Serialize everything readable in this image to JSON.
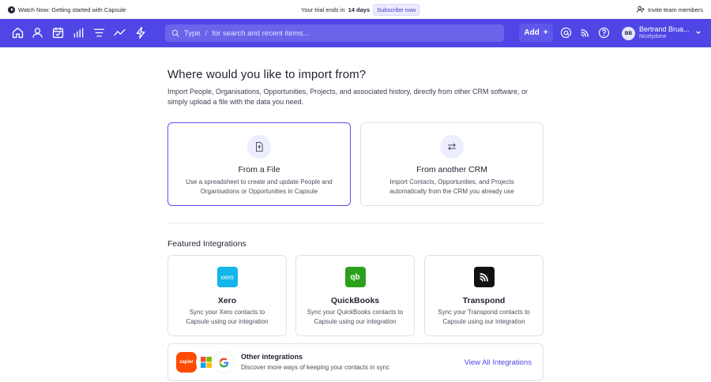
{
  "topbar": {
    "watch_label": "Watch Now: Getting started with Capsule",
    "trial_prefix": "Your trial ends in",
    "trial_days": "14 days",
    "subscribe_label": "Subscribe now",
    "invite_label": "Invite team members"
  },
  "navbar": {
    "icons": [
      "home-icon",
      "person-icon",
      "calendar-icon",
      "reports-icon",
      "filters-icon",
      "activity-icon",
      "workflow-icon"
    ],
    "search_type_label": "Type",
    "search_slash": "/",
    "search_placeholder": "for search and recent items...",
    "add_label": "Add",
    "add_symbol": "+",
    "user_initials": "BB",
    "user_name": "Bertrand Brua...",
    "user_org": "Nicelydone"
  },
  "main": {
    "title": "Where would you like to import from?",
    "intro": "Import People, Organisations, Opportunities, Projects, and associated history, directly from other CRM software, or simply upload a file with the data you need.",
    "options": [
      {
        "title": "From a File",
        "desc": "Use a spreadsheet to create and update People and Organisations or Opportunities in Capsule",
        "icon": "file-upload-icon"
      },
      {
        "title": "From another CRM",
        "desc": "Import Contacts, Opportunities, and Projects automatically from the CRM you already use",
        "icon": "transfer-arrows-icon"
      }
    ],
    "featured_title": "Featured Integrations",
    "integrations": [
      {
        "title": "Xero",
        "desc": "Sync your Xero contacts to Capsule using our integration",
        "logo_text": "xero",
        "color": "#13b5ea"
      },
      {
        "title": "QuickBooks",
        "desc": "Sync your QuickBooks contacts to Capsule using our integration",
        "logo_text": "qb",
        "color": "#2ca01c"
      },
      {
        "title": "Transpond",
        "desc": "Sync your Transpond contacts to Capsule using our integration",
        "logo_text": "",
        "color": "#111111"
      }
    ],
    "other": {
      "title": "Other integrations",
      "desc": "Discover more ways of keeping your contacts in sync",
      "link": "View All Integrations",
      "zapier_label": "zapier"
    }
  },
  "colors": {
    "brand": "#4f46e5",
    "selected_border": "#5b54e8"
  }
}
